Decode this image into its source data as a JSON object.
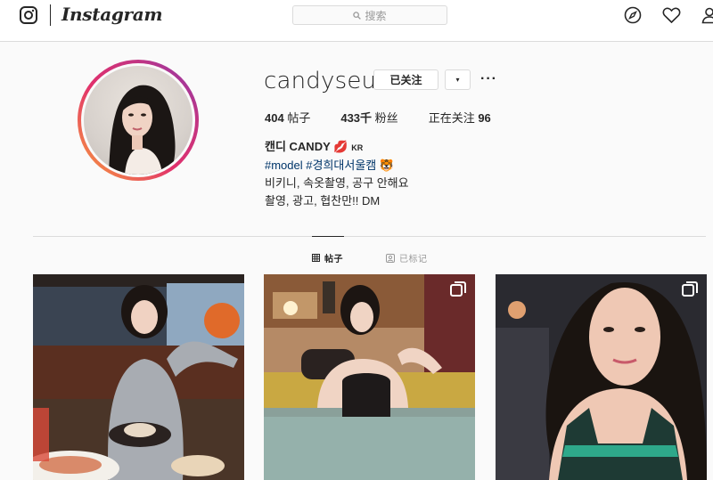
{
  "brand": {
    "wordmark": "Instagram"
  },
  "search": {
    "placeholder": "搜索"
  },
  "nav": {
    "icons": [
      "explore-icon",
      "activity-heart-icon",
      "profile-icon"
    ]
  },
  "profile": {
    "username": "candyseul",
    "follow_label": "已关注",
    "dropdown_label": "▾",
    "more_label": "···",
    "stats": {
      "posts": {
        "value": "404",
        "label": "帖子"
      },
      "followers": {
        "value": "433千",
        "label": "粉丝"
      },
      "following": {
        "label": "正在关注",
        "value": "96"
      }
    },
    "bio": {
      "name": "캔디 CANDY",
      "name_emoji": "💋",
      "flag": "KR",
      "tag1": "#model",
      "tag2": "#경희대서울캠",
      "tag_emoji": "🐯",
      "line3": "비키니, 속옷촬영, 공구 안해요",
      "line4": "촬영, 광고, 협찬만!! DM"
    }
  },
  "tabs": [
    {
      "label": "帖子",
      "icon": "grid-icon",
      "active": true
    },
    {
      "label": "已标记",
      "icon": "tagged-icon",
      "active": false
    }
  ],
  "colors": {
    "link": "#003569",
    "border": "#dbdbdb",
    "background": "#fafafa"
  }
}
